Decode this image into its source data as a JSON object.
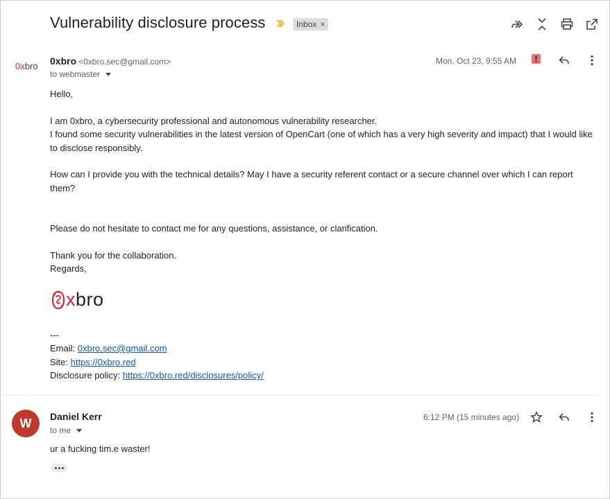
{
  "thread": {
    "subject": "Vulnerability disclosure process",
    "label": "Inbox",
    "label_remove": "×"
  },
  "toolbar_icons": [
    "forward-all-icon",
    "collapse-all-icon",
    "print-icon",
    "open-new-window-icon"
  ],
  "message1": {
    "logo_text_zero": "0x",
    "logo_text_rest": "bro",
    "sender_name": "0xbro",
    "sender_email": "<0xbro.sec@gmail.com>",
    "recipients": "to webmaster",
    "date": "Mon, Oct 23, 9:55 AM",
    "greeting": "Hello,",
    "para1_line1": "I am 0xbro, a cybersecurity professional and autonomous vulnerability researcher.",
    "para1_line2": "I found some security vulnerabilities in the latest version of OpenCart (one of which has a very high severity and impact) that I would like to disclose responsibly.",
    "para2": "How can I provide you with the technical details? May I have a security referent contact or a secure channel over which I can report them?",
    "para3": "Please do not hesitate to contact me for any questions, assistance, or clarification.",
    "thanks": "Thank you for the collaboration.",
    "regards": "Regards,",
    "sig_logo_x": "x",
    "sig_logo_bro": "bro",
    "sig_sep": "---",
    "email_label": "Email: ",
    "email_link": "0xbro.sec@gmail.com",
    "site_label": "Site: ",
    "site_link": "https://0xbro.red",
    "policy_label": "Disclosure policy: ",
    "policy_link": "https://0xbro.red/disclosures/policy/"
  },
  "message2": {
    "avatar_letter": "W",
    "avatar_color": "#c0392b",
    "sender_name": "Daniel Kerr",
    "recipients": "to me",
    "date": "6:12 PM (15 minutes ago)",
    "body": "ur a fucking tim.e waster!"
  },
  "colors": {
    "link": "#1155cc",
    "brand_red": "#d3272e",
    "important_marker": "#f4c542",
    "report_badge": "#e57373"
  }
}
